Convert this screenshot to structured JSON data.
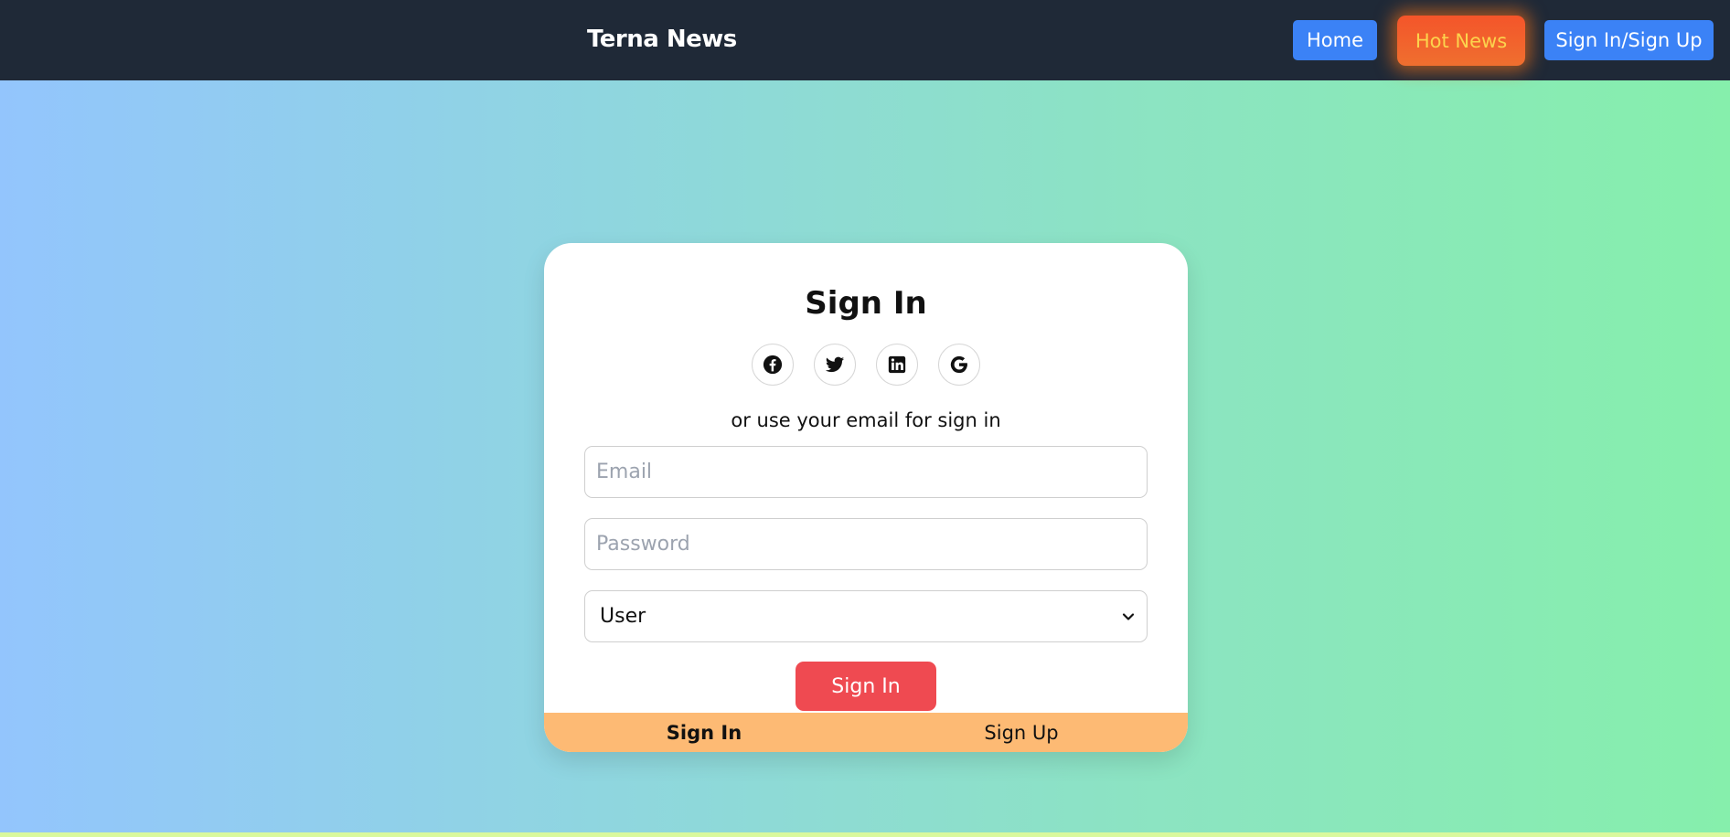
{
  "navbar": {
    "brand": "Terna News",
    "links": [
      {
        "label": "Home"
      },
      {
        "label": "Hot News"
      },
      {
        "label": "Sign In/Sign Up"
      }
    ]
  },
  "signin_card": {
    "title": "Sign In",
    "social_icons": [
      "facebook-icon",
      "twitter-icon",
      "linkedin-icon",
      "google-icon"
    ],
    "hint": "or use your email for sign in",
    "email_placeholder": "Email",
    "password_placeholder": "Password",
    "role_selected": "User",
    "submit_label": "Sign In",
    "tabs": [
      {
        "label": "Sign In",
        "active": true
      },
      {
        "label": "Sign Up",
        "active": false
      }
    ]
  },
  "colors": {
    "navbar_bg": "#1f2937",
    "nav_button": "#3b82f6",
    "hot_button": "#f4552a",
    "hot_text": "#fcd34d",
    "submit": "#ef4a51",
    "tab_bar": "#fdba74",
    "gradient_start": "#93c5fd",
    "gradient_end": "#86efac"
  }
}
